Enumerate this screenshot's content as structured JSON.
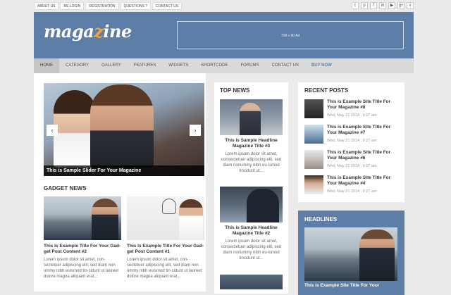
{
  "toplinks": [
    "ABOUT US",
    "RE LOGIN",
    "REGISTRATION",
    "QUESTIONS ?",
    "CONTACT US"
  ],
  "social": [
    {
      "name": "twitter-icon",
      "glyph": "t"
    },
    {
      "name": "pinterest-icon",
      "glyph": "p"
    },
    {
      "name": "facebook-icon",
      "glyph": "f"
    },
    {
      "name": "linkedin-icon",
      "glyph": "in"
    },
    {
      "name": "youtube-icon",
      "glyph": "▶"
    },
    {
      "name": "googleplus-icon",
      "glyph": "g+"
    },
    {
      "name": "vimeo-icon",
      "glyph": "v"
    }
  ],
  "logo": {
    "part1": "maga",
    "accent": "z",
    "part2": "ine"
  },
  "ad": "728 x 90 Ad",
  "nav": [
    "HOME",
    "CATEGORY",
    "GALLERY",
    "FEATURES",
    "WIDGETS",
    "SHORTCODE",
    "FORUMS",
    "CONTACT US",
    "BUY NOW"
  ],
  "slider": {
    "caption": "This is Sample Slider For Your Magazine",
    "prev": "‹",
    "next": "›"
  },
  "gadget": {
    "title": "GADGET NEWS",
    "posts": [
      {
        "title": "This Is Example Title For Your Gad-get Post Content #2",
        "excerpt": "Lorem ipsum dolor sit amet, con-sectetuer adipiscing elit, sed diam non ummy nibh euismod tin-cidunt ut laoreet dolore magna aliquam erat..."
      },
      {
        "title": "This Is Example Title For Your Gad-get Post Content #1",
        "excerpt": "Lorem ipsum dolor sit amet, con-sectetuer adipiscing elit, sed diam non ummy nibh euismod tin-cidunt ut laoreet dolore magna aliquam erat..."
      }
    ]
  },
  "topnews": {
    "title": "TOP NEWS",
    "posts": [
      {
        "title": "This is Sample Headline Magazine Title #3",
        "excerpt": "Lorem ipsum dolor sit amet, consectetuer adipiscing elit, sed diam nonummy nibh eu-ismod tincidunt ut..."
      },
      {
        "title": "This is Sample Headline Magazine Title #2",
        "excerpt": "Lorem ipsum dolor sit amet, consectetuer adipiscing elit, sed diam nonummy nibh eu-ismod tincidunt ut..."
      }
    ]
  },
  "recent": {
    "title": "RECENT POSTS",
    "posts": [
      {
        "title": "This is Example Site Title For Your Magazine #8",
        "date": "Wed, May 21 2014 , 9:27 am"
      },
      {
        "title": "This is Example Site Title For Your Magazine #7",
        "date": "Wed, May 21 2014 , 9:27 am"
      },
      {
        "title": "This is Example Site Title For Your Magazine #6",
        "date": "Wed, May 21 2014 , 9:27 am"
      },
      {
        "title": "This is Example Site Title For Your Magazine #4",
        "date": "Wed, May 21 2014 , 9:27 am"
      }
    ]
  },
  "headlines": {
    "title": "HEADLINES",
    "post": "This is Example Site Title For Your"
  }
}
